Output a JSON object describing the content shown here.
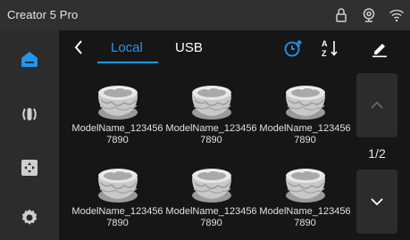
{
  "app": {
    "title": "Creator 5 Pro"
  },
  "status_icons": [
    "lock-icon",
    "webcam-icon",
    "wifi-icon"
  ],
  "sidebar": {
    "items": [
      {
        "name": "home",
        "icon": "home-icon",
        "active": true
      },
      {
        "name": "control",
        "icon": "control-icon",
        "active": false
      },
      {
        "name": "move",
        "icon": "move-icon",
        "active": false
      },
      {
        "name": "settings",
        "icon": "gear-icon",
        "active": false
      }
    ]
  },
  "tabs": {
    "local": "Local",
    "usb": "USB"
  },
  "toolbar": {
    "icons": [
      "sort-by-time-icon",
      "sort-alphabetical-icon",
      "edit-icon"
    ]
  },
  "files": [
    {
      "name": "ModelName_1234567890"
    },
    {
      "name": "ModelName_1234567890"
    },
    {
      "name": "ModelName_1234567890"
    },
    {
      "name": "ModelName_1234567890"
    },
    {
      "name": "ModelName_1234567890"
    },
    {
      "name": "ModelName_1234567890"
    }
  ],
  "pager": {
    "page_label": "1/2"
  },
  "colors": {
    "accent": "#2196f3",
    "panel": "#2c2c2c",
    "background": "#161616"
  }
}
